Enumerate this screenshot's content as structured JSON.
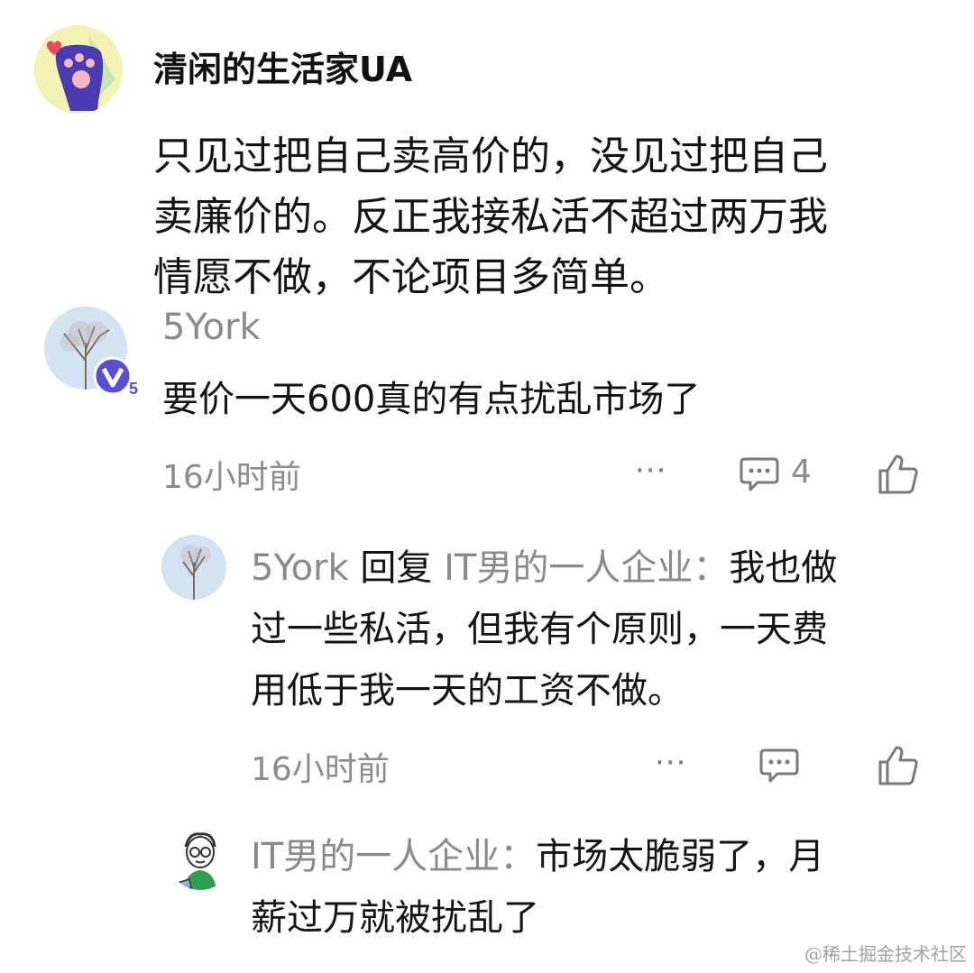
{
  "main_comment": {
    "username": "清闲的生活家UA",
    "text_lines": [
      "只见过把自己卖高价的，没见过把自己",
      "卖廉价的。反正我接私活不超过两万我",
      "情愿不做，不论项目多简单。"
    ]
  },
  "reply_1": {
    "username": "5York",
    "vip_level": "5",
    "text": "要价一天600真的有点扰乱市场了",
    "time": "16小时前",
    "more_label": "···",
    "comment_count": "4"
  },
  "reply_2": {
    "username": "5York",
    "reply_word": " 回复 ",
    "reply_target": "IT男的一人企业：",
    "text_line1": "我也做",
    "text_lines": [
      "过一些私活，但我有个原则，一天费",
      "用低于我一天的工资不做。"
    ],
    "time": "16小时前",
    "more_label": "···"
  },
  "reply_3": {
    "username": "IT男的一人企业：",
    "text_line1": "市场太脆弱了，月",
    "text_lines": [
      "薪过万就被扰乱了"
    ]
  },
  "watermark": "@稀土掘金技术社区",
  "icons": {
    "comment": "comment-icon",
    "like": "thumbs-up-icon",
    "more": "more-dots-icon",
    "vip": "vip-badge-icon"
  },
  "colors": {
    "text": "#141414",
    "secondary": "#8a8a8a",
    "vip_badge": "#5a4fcf"
  }
}
